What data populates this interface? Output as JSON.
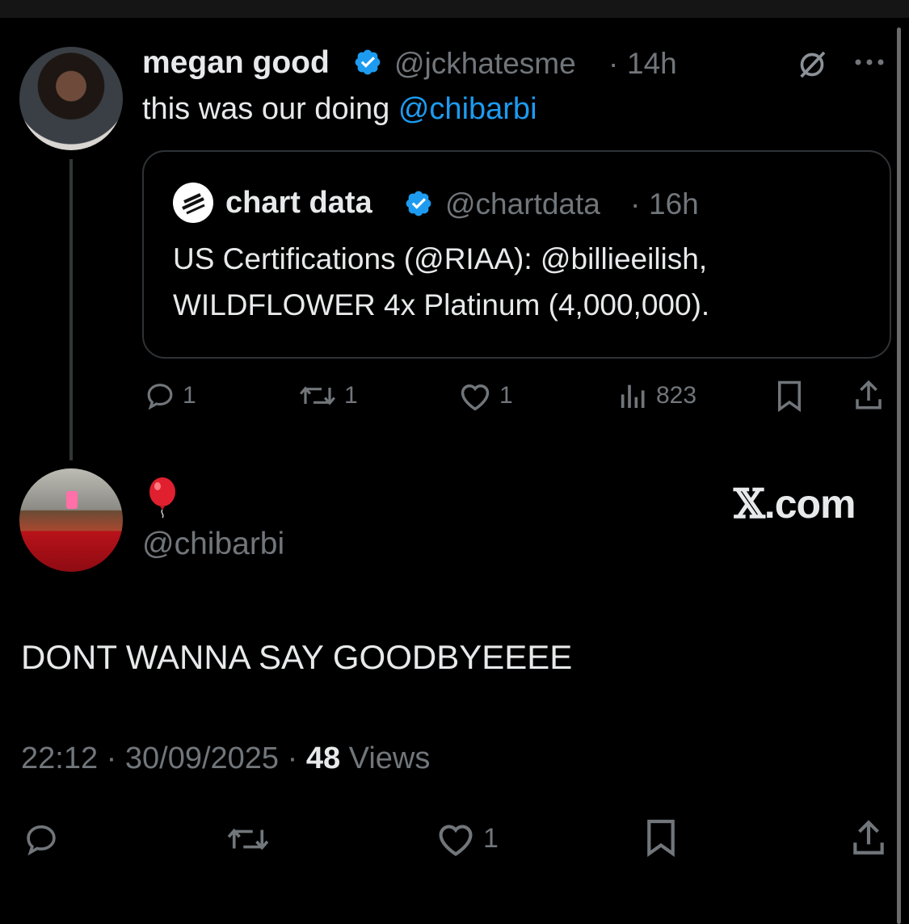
{
  "tweet": {
    "display_name": "megan good",
    "handle": "@jckhatesme",
    "time": "14h",
    "text": "this was our doing",
    "mention": "@chibarbi",
    "quote": {
      "display_name": "chart data",
      "handle": "@chartdata",
      "time": "16h",
      "line1": "US Certifications (@RIAA): @billieeilish,",
      "line2": "WILDFLOWER 4x Platinum (4,000,000)."
    },
    "actions": {
      "replies": "1",
      "reposts": "1",
      "likes": "1",
      "views": "823"
    }
  },
  "reply": {
    "display_name_emoji": "🎈",
    "handle": "@chibarbi",
    "watermark_x": "𝕏",
    "watermark_domain": ".com",
    "text": "DONT WANNA SAY GOODBYEEEE",
    "timestamp": "22:12 · 30/09/2025 · ",
    "views_count": "48",
    "views_label": " Views",
    "actions": {
      "likes": "1"
    }
  },
  "separator": "·",
  "colors": {
    "background": "#000000",
    "text": "#e7e9ea",
    "muted": "#71767b",
    "accent": "#1d9bf0"
  }
}
